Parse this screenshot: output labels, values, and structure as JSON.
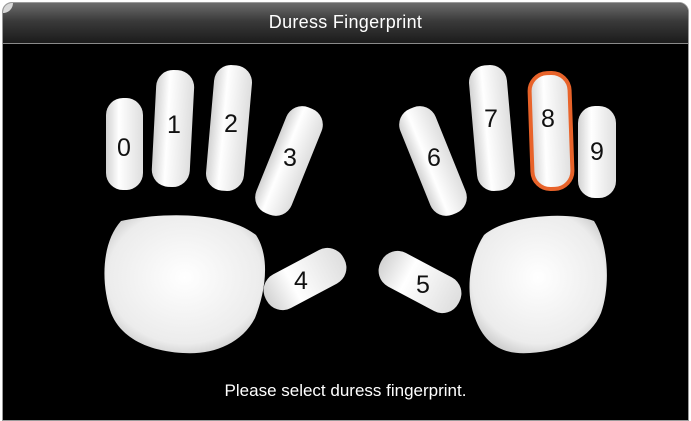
{
  "window": {
    "title": "Duress Fingerprint"
  },
  "fingers": [
    {
      "label": "0",
      "selected": false
    },
    {
      "label": "1",
      "selected": false
    },
    {
      "label": "2",
      "selected": false
    },
    {
      "label": "3",
      "selected": false
    },
    {
      "label": "4",
      "selected": false
    },
    {
      "label": "5",
      "selected": false
    },
    {
      "label": "6",
      "selected": false
    },
    {
      "label": "7",
      "selected": false
    },
    {
      "label": "8",
      "selected": true
    },
    {
      "label": "9",
      "selected": false
    }
  ],
  "status": {
    "message": "Please select duress fingerprint."
  },
  "colors": {
    "background": "#000000",
    "finger": "#f2f2f2",
    "selected_outline": "#e8632a"
  }
}
